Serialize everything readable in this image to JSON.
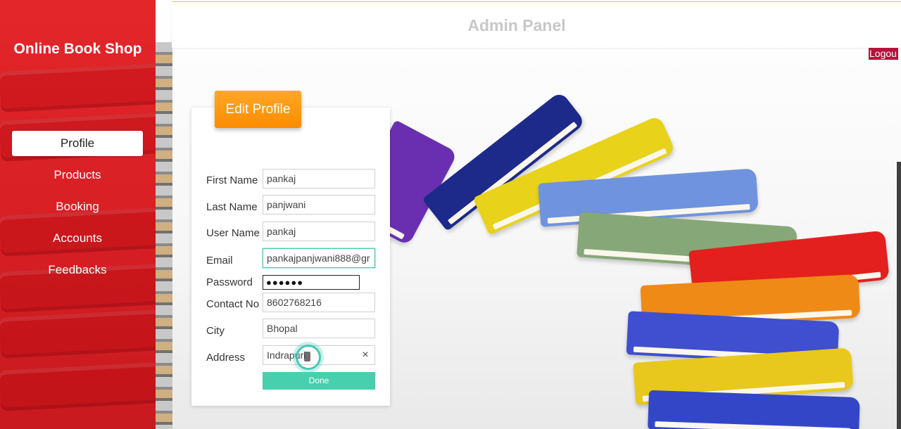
{
  "sidebar": {
    "brand": "Online Book Shop",
    "items": [
      {
        "label": "Profile",
        "active": true
      },
      {
        "label": "Products",
        "active": false
      },
      {
        "label": "Booking",
        "active": false
      },
      {
        "label": "Accounts",
        "active": false
      },
      {
        "label": "Feedbacks",
        "active": false
      }
    ]
  },
  "header": {
    "title": "Admin Panel",
    "logout_label": "Logou"
  },
  "form": {
    "heading": "Edit Profile",
    "fields": {
      "first_name": {
        "label": "First Name",
        "value": "pankaj"
      },
      "last_name": {
        "label": "Last Name",
        "value": "panjwani"
      },
      "user_name": {
        "label": "User Name",
        "value": "pankaj"
      },
      "email": {
        "label": "Email",
        "value": "pankajpanjwani888@gr"
      },
      "password": {
        "label": "Password",
        "value": "●●●●●●"
      },
      "contact": {
        "label": "Contact No",
        "value": "8602768216"
      },
      "city": {
        "label": "City",
        "value": "Bhopal"
      },
      "address": {
        "label": "Address",
        "value": "Indrapuri"
      }
    },
    "clear_icon": "×",
    "done_label": "Done"
  },
  "colors": {
    "sidebar_red": "#d61f24",
    "heading_orange": "#fb8c00",
    "done_teal": "#48cfad",
    "logout_bg": "#b8123a"
  },
  "icons": {
    "clear": "clear-icon",
    "cursor": "text-cursor-icon"
  }
}
